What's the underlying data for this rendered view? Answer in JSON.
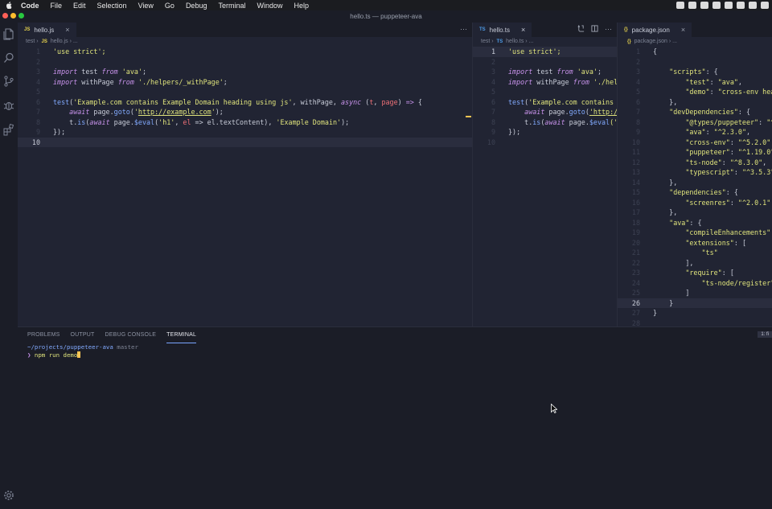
{
  "menubar": {
    "app": "Code",
    "items": [
      "File",
      "Edit",
      "Selection",
      "View",
      "Go",
      "Debug",
      "Terminal",
      "Window",
      "Help"
    ]
  },
  "window": {
    "title": "hello.ts — puppeteer-ava"
  },
  "colors": {
    "keyword": "#c792ea",
    "string": "#dfe37c",
    "function": "#82aaff",
    "plain": "#c8ccd8",
    "param": "#f07178",
    "punct": "#7fd3e0",
    "traffic_close": "#fe5f57",
    "traffic_min": "#febc2e",
    "traffic_max": "#28c840"
  },
  "panes": [
    {
      "tab": {
        "label": "hello.js",
        "icon": "JS",
        "close": "×"
      },
      "breadcrumb": {
        "folder": "test",
        "icon": "JS",
        "file": "hello.js",
        "more": "..."
      },
      "active_line": 10,
      "lines": [
        [
          [
            "'use strict';",
            "string"
          ]
        ],
        [],
        [
          [
            "import",
            "keyword"
          ],
          [
            " test ",
            "plain"
          ],
          [
            "from",
            "keyword"
          ],
          [
            " 'ava'",
            "string"
          ],
          [
            ";",
            "plain"
          ]
        ],
        [
          [
            "import",
            "keyword"
          ],
          [
            " withPage ",
            "plain"
          ],
          [
            "from",
            "keyword"
          ],
          [
            " './helpers/_withPage'",
            "string"
          ],
          [
            ";",
            "plain"
          ]
        ],
        [],
        [
          [
            "test",
            "function"
          ],
          [
            "(",
            "plain"
          ],
          [
            "'Example.com contains Example Domain heading using js'",
            "string"
          ],
          [
            ", withPage, ",
            "plain"
          ],
          [
            "async",
            "keyword"
          ],
          [
            " (",
            "plain"
          ],
          [
            "t",
            "param"
          ],
          [
            ", ",
            "plain"
          ],
          [
            "page",
            "param"
          ],
          [
            ") ",
            "plain"
          ],
          [
            "=>",
            "keyword"
          ],
          [
            " {",
            "plain"
          ]
        ],
        [
          [
            "    ",
            "plain"
          ],
          [
            "await",
            "keyword"
          ],
          [
            " page.",
            "plain"
          ],
          [
            "goto",
            "function"
          ],
          [
            "(",
            "plain"
          ],
          [
            "'",
            "string"
          ],
          [
            "http://example.com",
            "string"
          ],
          [
            "'",
            "string"
          ],
          [
            ");",
            "plain"
          ]
        ],
        [
          [
            "    t.",
            "plain"
          ],
          [
            "is",
            "function"
          ],
          [
            "(",
            "plain"
          ],
          [
            "await",
            "keyword"
          ],
          [
            " page.",
            "plain"
          ],
          [
            "$eval",
            "function"
          ],
          [
            "(",
            "plain"
          ],
          [
            "'h1'",
            "string"
          ],
          [
            ", ",
            "plain"
          ],
          [
            "el",
            "param"
          ],
          [
            " => el.textContent), ",
            "plain"
          ],
          [
            "'Example Domain'",
            "string"
          ],
          [
            ");",
            "plain"
          ]
        ],
        [
          [
            "});",
            "plain"
          ]
        ],
        []
      ]
    },
    {
      "tab": {
        "label": "hello.ts",
        "icon": "TS",
        "close": "×"
      },
      "breadcrumb": {
        "folder": "test",
        "icon": "TS",
        "file": "hello.ts",
        "more": "..."
      },
      "active_line": 1,
      "lines": [
        [
          [
            "'use strict';",
            "string"
          ]
        ],
        [],
        [
          [
            "import",
            "keyword"
          ],
          [
            " test ",
            "plain"
          ],
          [
            "from",
            "keyword"
          ],
          [
            " 'ava'",
            "string"
          ],
          [
            ";",
            "plain"
          ]
        ],
        [
          [
            "import",
            "keyword"
          ],
          [
            " withPage ",
            "plain"
          ],
          [
            "from",
            "keyword"
          ],
          [
            " './help",
            "string"
          ]
        ],
        [],
        [
          [
            "test",
            "function"
          ],
          [
            "(",
            "plain"
          ],
          [
            "'Example.com contains E",
            "string"
          ]
        ],
        [
          [
            "    ",
            "plain"
          ],
          [
            "await",
            "keyword"
          ],
          [
            " page.",
            "plain"
          ],
          [
            "goto",
            "function"
          ],
          [
            "(",
            "plain"
          ],
          [
            "'http:/",
            "string"
          ]
        ],
        [
          [
            "    t.",
            "plain"
          ],
          [
            "is",
            "function"
          ],
          [
            "(",
            "plain"
          ],
          [
            "await",
            "keyword"
          ],
          [
            " page.",
            "plain"
          ],
          [
            "$eval",
            "function"
          ],
          [
            "('",
            "string"
          ]
        ],
        [
          [
            "});",
            "plain"
          ]
        ],
        []
      ]
    },
    {
      "tab": {
        "label": "package.json",
        "icon": "{}",
        "close": "×"
      },
      "breadcrumb": {
        "icon": "{}",
        "file": "package.json",
        "more": "..."
      },
      "active_line": 26,
      "lines": [
        [
          [
            "{",
            "plain"
          ]
        ],
        [],
        [
          [
            "    ",
            "plain"
          ],
          [
            "\"scripts\"",
            "string"
          ],
          [
            ": {",
            "plain"
          ]
        ],
        [
          [
            "        ",
            "plain"
          ],
          [
            "\"test\"",
            "string"
          ],
          [
            ": ",
            "plain"
          ],
          [
            "\"ava\"",
            "string"
          ],
          [
            ",",
            "plain"
          ]
        ],
        [
          [
            "        ",
            "plain"
          ],
          [
            "\"demo\"",
            "string"
          ],
          [
            ": ",
            "plain"
          ],
          [
            "\"cross-env hea",
            "string"
          ]
        ],
        [
          [
            "    },",
            "plain"
          ]
        ],
        [
          [
            "    ",
            "plain"
          ],
          [
            "\"devDependencies\"",
            "string"
          ],
          [
            ": {",
            "plain"
          ]
        ],
        [
          [
            "        ",
            "plain"
          ],
          [
            "\"@types/puppeteer\"",
            "string"
          ],
          [
            ": ",
            "plain"
          ],
          [
            "\"^",
            "string"
          ]
        ],
        [
          [
            "        ",
            "plain"
          ],
          [
            "\"ava\"",
            "string"
          ],
          [
            ": ",
            "plain"
          ],
          [
            "\"^2.3.0\"",
            "string"
          ],
          [
            ",",
            "plain"
          ]
        ],
        [
          [
            "        ",
            "plain"
          ],
          [
            "\"cross-env\"",
            "string"
          ],
          [
            ": ",
            "plain"
          ],
          [
            "\"^5.2.0\"",
            "string"
          ],
          [
            ",",
            "plain"
          ]
        ],
        [
          [
            "        ",
            "plain"
          ],
          [
            "\"puppeteer\"",
            "string"
          ],
          [
            ": ",
            "plain"
          ],
          [
            "\"^1.19.0\"",
            "string"
          ],
          [
            ",",
            "plain"
          ]
        ],
        [
          [
            "        ",
            "plain"
          ],
          [
            "\"ts-node\"",
            "string"
          ],
          [
            ": ",
            "plain"
          ],
          [
            "\"^8.3.0\"",
            "string"
          ],
          [
            ",",
            "plain"
          ]
        ],
        [
          [
            "        ",
            "plain"
          ],
          [
            "\"typescript\"",
            "string"
          ],
          [
            ": ",
            "plain"
          ],
          [
            "\"^3.5.3\"",
            "string"
          ]
        ],
        [
          [
            "    },",
            "plain"
          ]
        ],
        [
          [
            "    ",
            "plain"
          ],
          [
            "\"dependencies\"",
            "string"
          ],
          [
            ": {",
            "plain"
          ]
        ],
        [
          [
            "        ",
            "plain"
          ],
          [
            "\"screenres\"",
            "string"
          ],
          [
            ": ",
            "plain"
          ],
          [
            "\"^2.0.1\"",
            "string"
          ]
        ],
        [
          [
            "    },",
            "plain"
          ]
        ],
        [
          [
            "    ",
            "plain"
          ],
          [
            "\"ava\"",
            "string"
          ],
          [
            ": {",
            "plain"
          ]
        ],
        [
          [
            "        ",
            "plain"
          ],
          [
            "\"compileEnhancements\"",
            "string"
          ],
          [
            ":",
            "plain"
          ]
        ],
        [
          [
            "        ",
            "plain"
          ],
          [
            "\"extensions\"",
            "string"
          ],
          [
            ": [",
            "plain"
          ]
        ],
        [
          [
            "            ",
            "plain"
          ],
          [
            "\"ts\"",
            "string"
          ]
        ],
        [
          [
            "        ],",
            "plain"
          ]
        ],
        [
          [
            "        ",
            "plain"
          ],
          [
            "\"require\"",
            "string"
          ],
          [
            ": [",
            "plain"
          ]
        ],
        [
          [
            "            ",
            "plain"
          ],
          [
            "\"ts-node/register\"",
            "string"
          ]
        ],
        [
          [
            "        ]",
            "plain"
          ]
        ],
        [
          [
            "    }",
            "plain"
          ]
        ],
        [
          [
            "}",
            "plain"
          ]
        ],
        []
      ]
    }
  ],
  "panel": {
    "tabs": [
      "PROBLEMS",
      "OUTPUT",
      "DEBUG CONSOLE",
      "TERMINAL"
    ],
    "active_tab": 3,
    "terminal_badge": "1: fi",
    "terminal": {
      "path": "~/projects/puppeteer-ava",
      "branch": "master",
      "prompt": "❯",
      "command": "npm run demo"
    }
  }
}
